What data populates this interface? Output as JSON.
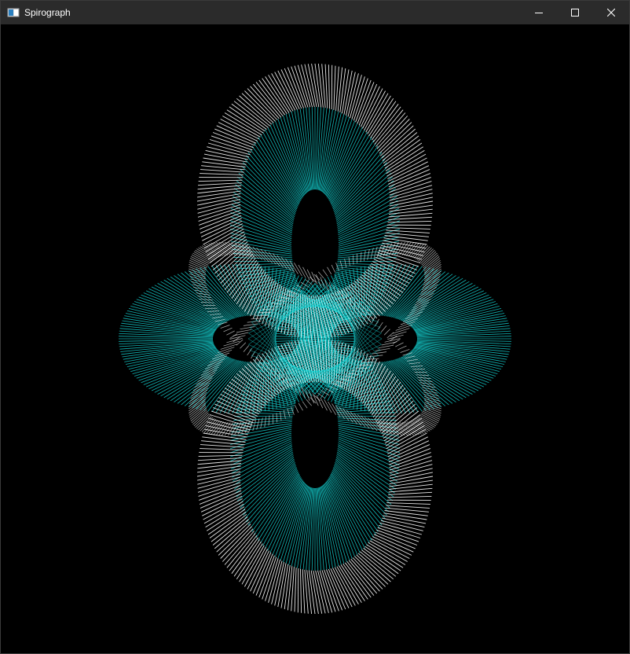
{
  "window": {
    "title": "Spirograph",
    "app_icon": "window-app-icon",
    "controls": {
      "minimize_icon": "minimize-icon",
      "maximize_icon": "maximize-icon",
      "close_icon": "close-icon"
    }
  },
  "colors": {
    "titlebar_bg": "#2b2b2b",
    "title_text": "#ffffff",
    "canvas_bg": "#000000",
    "outer_lines": "#ffffff",
    "inner_lines": "#14d6d6"
  },
  "drawing": {
    "description_icon": "spirograph-drawing",
    "line_count": 180
  }
}
